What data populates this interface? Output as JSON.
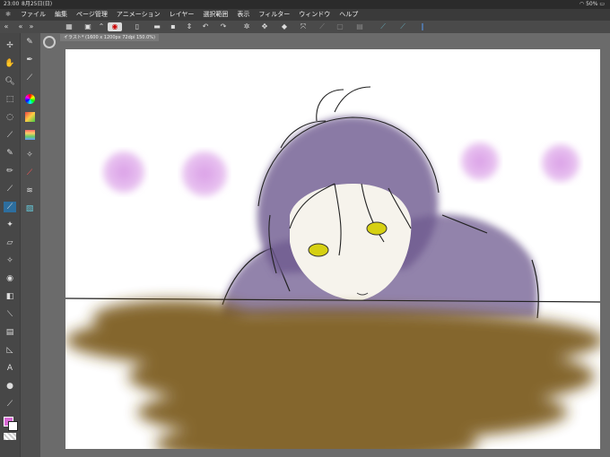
{
  "status": {
    "time": "23:00",
    "date": "8月25日(日)",
    "battery": "50%"
  },
  "menu": [
    "ファイル",
    "編集",
    "ページ管理",
    "アニメーション",
    "レイヤー",
    "選択範囲",
    "表示",
    "フィルター",
    "ウィンドウ",
    "ヘルプ"
  ],
  "tab": {
    "title": "イラスト* (1600 x 1200px 72dpi 150.0%)"
  },
  "colors": {
    "primary": "#d76ad4",
    "hair": "#6e5a8f",
    "table": "#7a5a1e",
    "eyes": "#d6d012",
    "dots": "#d99be6"
  },
  "help_label": "?"
}
